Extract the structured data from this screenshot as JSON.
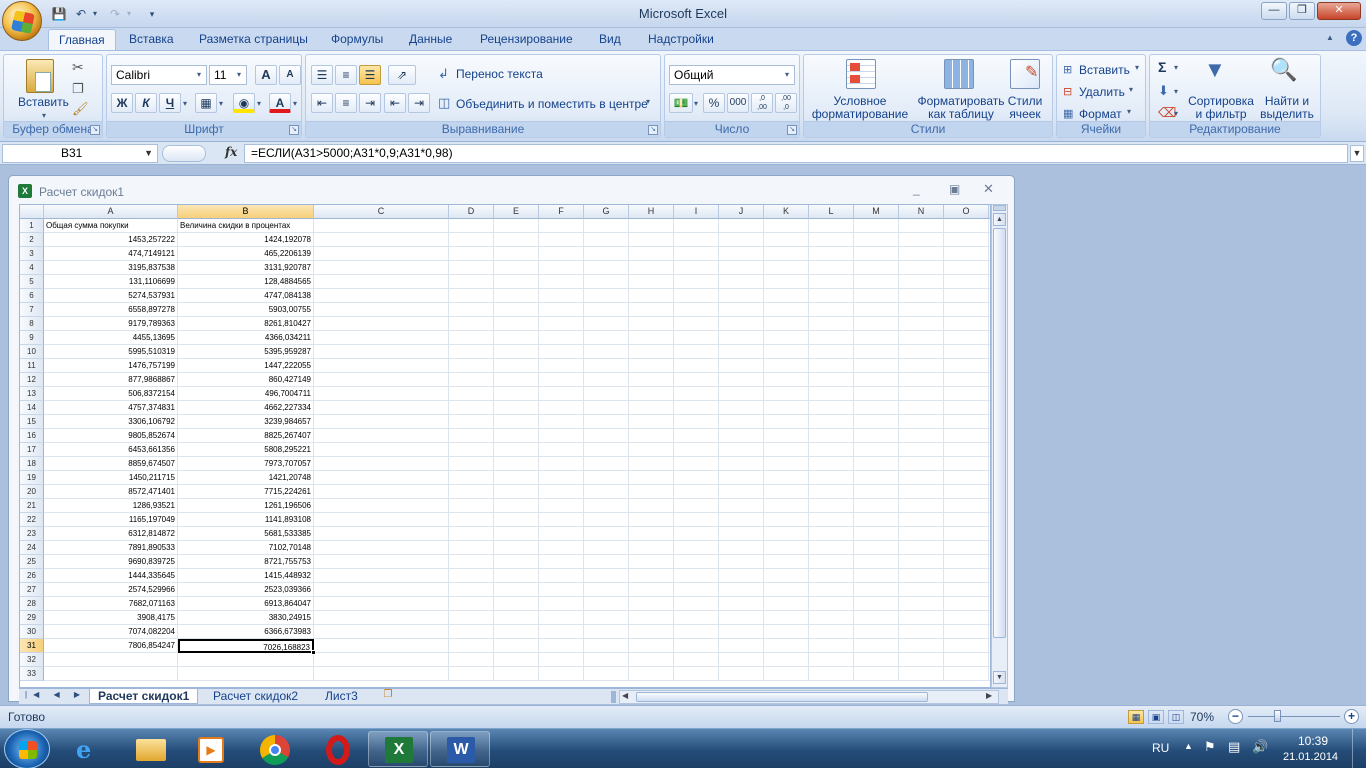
{
  "app": {
    "title": "Microsoft Excel"
  },
  "tabs": [
    "Главная",
    "Вставка",
    "Разметка страницы",
    "Формулы",
    "Данные",
    "Рецензирование",
    "Вид",
    "Надстройки"
  ],
  "active_tab": "Главная",
  "ribbon": {
    "clipboard": {
      "paste": "Вставить",
      "label": "Буфер обмена"
    },
    "font": {
      "name": "Calibri",
      "size": "11",
      "bold": "Ж",
      "italic": "К",
      "underline": "Ч",
      "grow": "A",
      "shrink": "A",
      "font_color": "A",
      "label": "Шрифт"
    },
    "alignment": {
      "wrap": "Перенос текста",
      "merge": "Объединить и поместить в центре",
      "label": "Выравнивание"
    },
    "number": {
      "format": "Общий",
      "percent": "%",
      "thousands": "000",
      "inc_dec": ",0\n,00",
      "dec_dec": ",00\n,0",
      "label": "Число"
    },
    "styles": {
      "conditional": "Условное\nформатирование",
      "as_table": "Форматировать\nкак таблицу",
      "cell_styles": "Стили\nячеек",
      "label": "Стили"
    },
    "cells": {
      "insert": "Вставить",
      "delete": "Удалить",
      "format": "Формат",
      "label": "Ячейки"
    },
    "editing": {
      "sum": "Σ",
      "sort": "Сортировка\nи фильтр",
      "find": "Найти и\nвыделить",
      "label": "Редактирование"
    }
  },
  "formula_bar": {
    "name_box": "B31",
    "fx": "fx",
    "formula": "=ЕСЛИ(A31>5000;A31*0,9;A31*0,98)"
  },
  "workbook": {
    "title": "Расчет скидок1"
  },
  "sheet": {
    "columns": [
      "A",
      "B",
      "C",
      "D",
      "E",
      "F",
      "G",
      "H",
      "I",
      "J",
      "K",
      "L",
      "M",
      "N",
      "O"
    ],
    "header_row": [
      "Общая сумма покупки",
      "Величина скидки в процентах"
    ],
    "rows": [
      [
        "1453,257222",
        "1424,192078"
      ],
      [
        "474,7149121",
        "465,2206139"
      ],
      [
        "3195,837538",
        "3131,920787"
      ],
      [
        "131,1106699",
        "128,4884565"
      ],
      [
        "5274,537931",
        "4747,084138"
      ],
      [
        "6558,897278",
        "5903,00755"
      ],
      [
        "9179,789363",
        "8261,810427"
      ],
      [
        "4455,13695",
        "4366,034211"
      ],
      [
        "5995,510319",
        "5395,959287"
      ],
      [
        "1476,757199",
        "1447,222055"
      ],
      [
        "877,9868867",
        "860,427149"
      ],
      [
        "506,8372154",
        "496,7004711"
      ],
      [
        "4757,374831",
        "4662,227334"
      ],
      [
        "3306,106792",
        "3239,984657"
      ],
      [
        "9805,852674",
        "8825,267407"
      ],
      [
        "6453,661356",
        "5808,295221"
      ],
      [
        "8859,674507",
        "7973,707057"
      ],
      [
        "1450,211715",
        "1421,20748"
      ],
      [
        "8572,471401",
        "7715,224261"
      ],
      [
        "1286,93521",
        "1261,196506"
      ],
      [
        "1165,197049",
        "1141,893108"
      ],
      [
        "6312,814872",
        "5681,533385"
      ],
      [
        "7891,890533",
        "7102,70148"
      ],
      [
        "9690,839725",
        "8721,755753"
      ],
      [
        "1444,335645",
        "1415,448932"
      ],
      [
        "2574,529966",
        "2523,039366"
      ],
      [
        "7682,071163",
        "6913,864047"
      ],
      [
        "3908,4175",
        "3830,24915"
      ],
      [
        "7074,082204",
        "6366,673983"
      ],
      [
        "7806,854247",
        "7026,168823"
      ]
    ],
    "row_numbers": [
      "1",
      "2",
      "3",
      "4",
      "5",
      "6",
      "7",
      "8",
      "9",
      "10",
      "11",
      "12",
      "13",
      "14",
      "15",
      "16",
      "17",
      "18",
      "19",
      "20",
      "21",
      "22",
      "23",
      "24",
      "25",
      "26",
      "27",
      "28",
      "29",
      "30",
      "31",
      "32",
      "33"
    ],
    "sheet_tabs": [
      "Расчет скидок1",
      "Расчет скидок2",
      "Лист3"
    ],
    "active_sheet": "Расчет скидок1"
  },
  "status": {
    "ready": "Готово",
    "zoom": "70%",
    "minus": "−",
    "plus": "+"
  },
  "taskbar": {
    "lang": "RU",
    "time": "10:39",
    "date": "21.01.2014"
  },
  "colors": {
    "accent": "#15428b",
    "selection": "#f7cf7a",
    "excel_green": "#1f7a3a"
  }
}
